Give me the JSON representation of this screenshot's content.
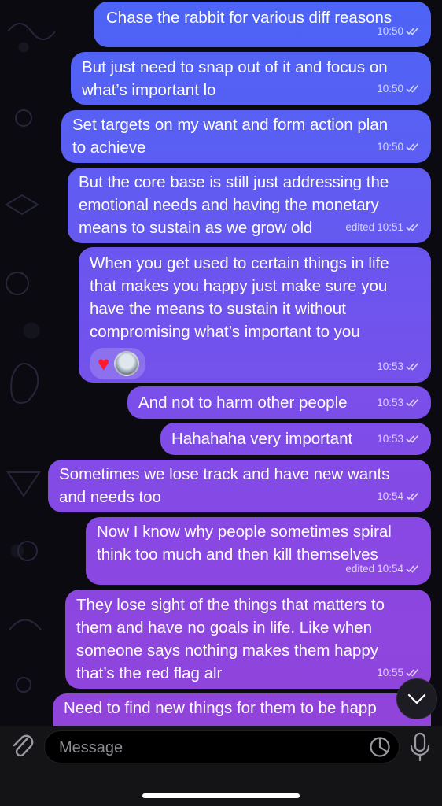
{
  "messages": [
    {
      "text": "Chase the rabbit for various diff reasons",
      "time": "10:50",
      "edited": ""
    },
    {
      "text": "But just need to snap out of it and focus on\nwhat’s important lo",
      "time": "10:50",
      "edited": ""
    },
    {
      "text": "Set targets on my want and form action plan\nto achieve",
      "time": "10:50",
      "edited": ""
    },
    {
      "text": "But the core base is still just addressing the\nemotional needs and having the monetary\nmeans to sustain as we grow old",
      "time": "10:51",
      "edited": "edited"
    },
    {
      "text": "When you get used to certain things in life\nthat makes you happy just make sure you\nhave the means to sustain it without\ncompromising what’s important to you",
      "time": "10:53",
      "edited": "",
      "reaction": "♥"
    },
    {
      "text": "And not to harm other people",
      "time": "10:53",
      "edited": ""
    },
    {
      "text": "Hahahaha very important",
      "time": "10:53",
      "edited": ""
    },
    {
      "text": "Sometimes we lose track and have new wants\nand needs too",
      "time": "10:54",
      "edited": ""
    },
    {
      "text": "Now I know why people sometimes spiral\nthink too much and then kill themselves",
      "time": "10:54",
      "edited": "edited"
    },
    {
      "text": "They lose sight of the things that matters to\nthem and have no goals in life. Like when\nsomeone says nothing makes them happy\nthat’s the red flag alr",
      "time": "10:55",
      "edited": ""
    },
    {
      "text": "Need to find new things for them to be happ",
      "time": "",
      "edited": ""
    }
  ],
  "composer": {
    "placeholder": "Message"
  },
  "icons": {
    "attach": "paperclip-icon",
    "sticker": "sticker-icon",
    "mic": "microphone-icon",
    "scroll": "chevron-down-icon",
    "read": "double-check-icon"
  },
  "colors": {
    "bubble_top": "#4f66f6",
    "bubble_bottom": "#8a47d8",
    "background": "#0a0a10",
    "composer_bar": "#141417"
  }
}
